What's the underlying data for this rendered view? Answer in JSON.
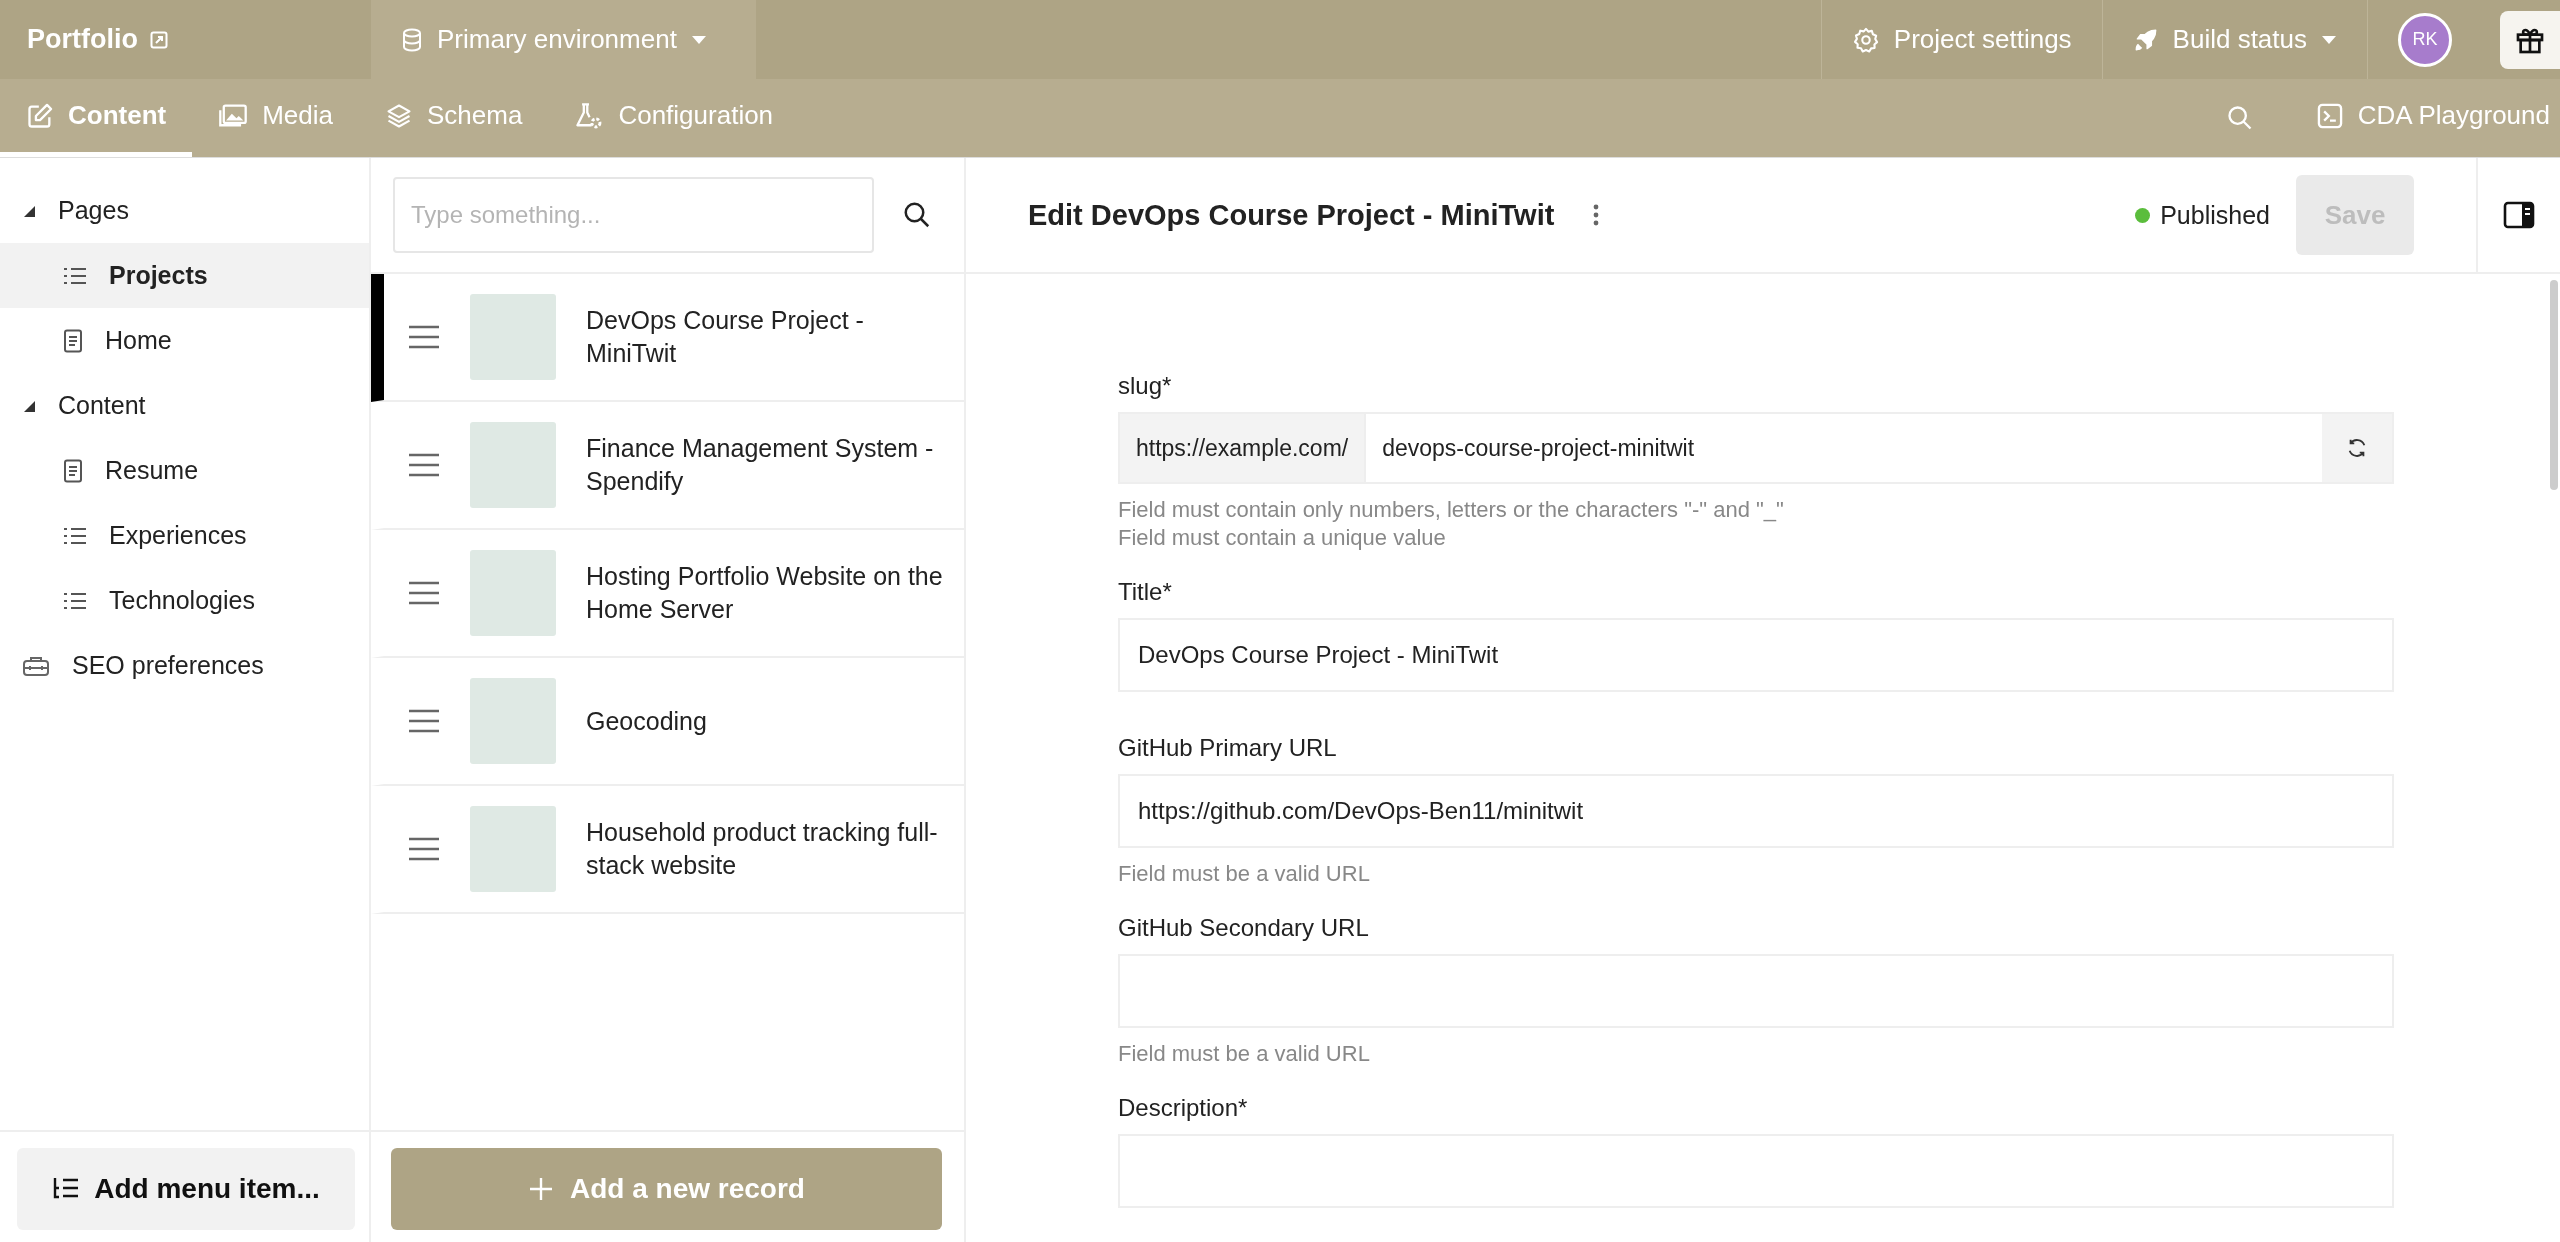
{
  "topbar": {
    "project": "Portfolio",
    "environment": "Primary environment",
    "project_settings": "Project settings",
    "build_status": "Build status",
    "avatar": "RK"
  },
  "nav": {
    "tabs": [
      {
        "label": "Content",
        "kind": "edit",
        "selected": true
      },
      {
        "label": "Media",
        "kind": "media",
        "selected": false
      },
      {
        "label": "Schema",
        "kind": "layers",
        "selected": false
      },
      {
        "label": "Configuration",
        "kind": "flask",
        "selected": false
      }
    ],
    "playground": "CDA Playground"
  },
  "sidebar": {
    "items": [
      {
        "label": "Pages",
        "kind": "group",
        "expanded": true,
        "children": [
          {
            "label": "Projects",
            "kind": "list",
            "selected": true
          },
          {
            "label": "Home",
            "kind": "page",
            "selected": false
          }
        ]
      },
      {
        "label": "Content",
        "kind": "group",
        "expanded": true,
        "children": [
          {
            "label": "Resume",
            "kind": "page",
            "selected": false
          },
          {
            "label": "Experiences",
            "kind": "list",
            "selected": false
          },
          {
            "label": "Technologies",
            "kind": "list",
            "selected": false
          }
        ]
      },
      {
        "label": "SEO preferences",
        "kind": "tool",
        "selected": false
      }
    ],
    "add_button": "Add menu item..."
  },
  "records": {
    "search": {
      "placeholder": "Type something..."
    },
    "items": [
      {
        "title": "DevOps Course Project - MiniTwit",
        "selected": true
      },
      {
        "title": "Finance Management System - Spendify",
        "selected": false
      },
      {
        "title": "Hosting Portfolio Website on the Home Server",
        "selected": false
      },
      {
        "title": "Geocoding",
        "selected": false
      },
      {
        "title": "Household product tracking full-stack website",
        "selected": false
      }
    ],
    "add_button": "Add a new record"
  },
  "editor": {
    "title": "Edit DevOps Course Project - MiniTwit",
    "status": {
      "label": "Published",
      "color": "#5bbd3c"
    },
    "save": {
      "label": "Save",
      "disabled": true
    },
    "fields": [
      {
        "kind": "slug",
        "label": "slug*",
        "prefix": "https://example.com/",
        "value": "devops-course-project-minitwit",
        "hints": [
          "Field must contain only numbers, letters or the characters \"-\" and \"_\"",
          "Field must contain a unique value"
        ]
      },
      {
        "kind": "text",
        "label": "Title*",
        "value": "DevOps Course Project - MiniTwit"
      },
      {
        "kind": "text",
        "label": "GitHub Primary URL",
        "value": "https://github.com/DevOps-Ben11/minitwit",
        "hints": [
          "Field must be a valid URL"
        ]
      },
      {
        "kind": "text",
        "label": "GitHub Secondary URL",
        "hints": [
          "Field must be a valid URL"
        ]
      },
      {
        "kind": "text",
        "label": "Description*"
      }
    ]
  }
}
